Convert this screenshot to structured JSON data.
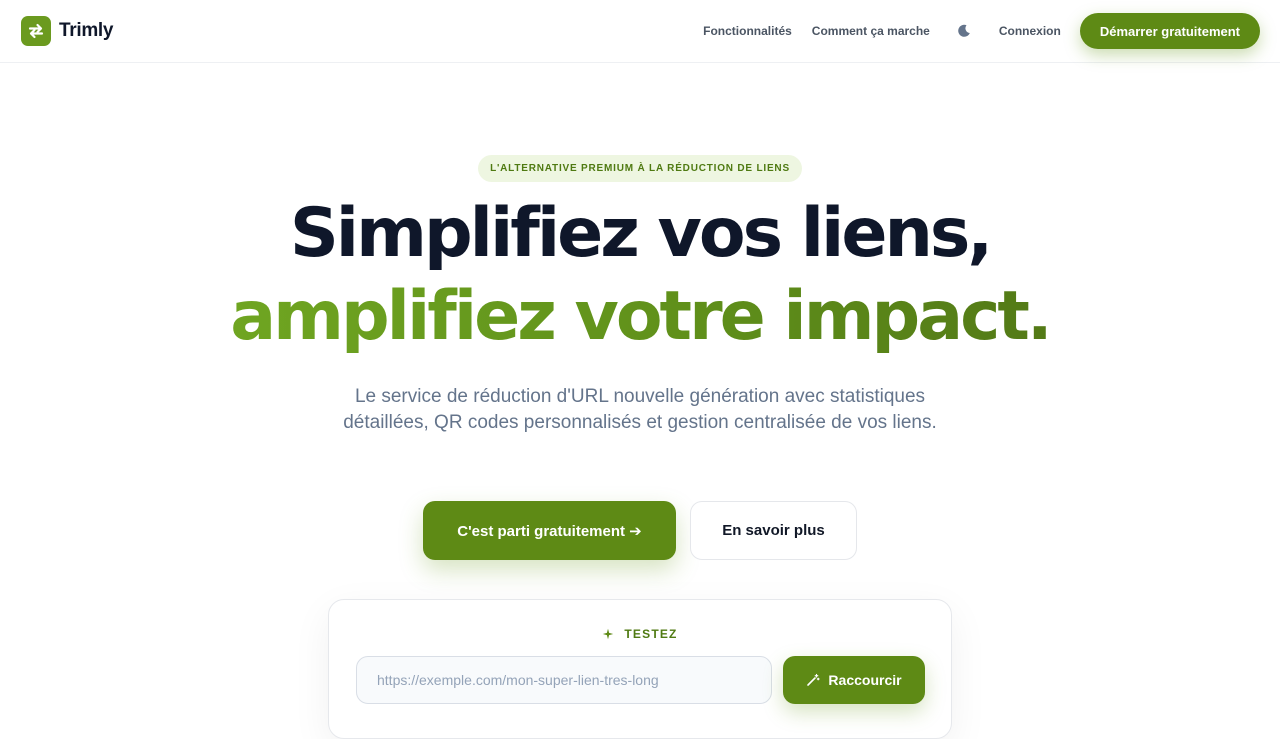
{
  "brand": {
    "name": "Trimly",
    "logo_icon": "swap-arrows-icon",
    "accent": "#6b9a1f"
  },
  "nav": {
    "links": [
      "Fonctionnalités",
      "Comment ça marche"
    ],
    "theme_icon": "moon-icon",
    "login": "Connexion",
    "cta": "Démarrer gratuitement"
  },
  "hero": {
    "badge": "L'ALTERNATIVE PREMIUM À LA RÉDUCTION DE LIENS",
    "headline_line1": "Simplifiez vos liens,",
    "headline_line2": "amplifiez votre impact.",
    "subtitle": "Le service de réduction d'URL nouvelle génération avec statistiques détaillées, QR codes personnalisés et gestion centralisée de vos liens.",
    "primary_cta": "C'est parti gratuitement ➔",
    "secondary_cta": "En savoir plus"
  },
  "demo": {
    "label": "TESTEZ",
    "label_icon": "sparkles-icon",
    "input_placeholder": "https://exemple.com/mon-super-lien-tres-long",
    "input_value": "",
    "button": "Raccourcir",
    "button_icon": "magic-wand-icon"
  },
  "colors": {
    "primary": "#5e8a15",
    "headline_dark": "#0f172a",
    "muted": "#64748b"
  }
}
